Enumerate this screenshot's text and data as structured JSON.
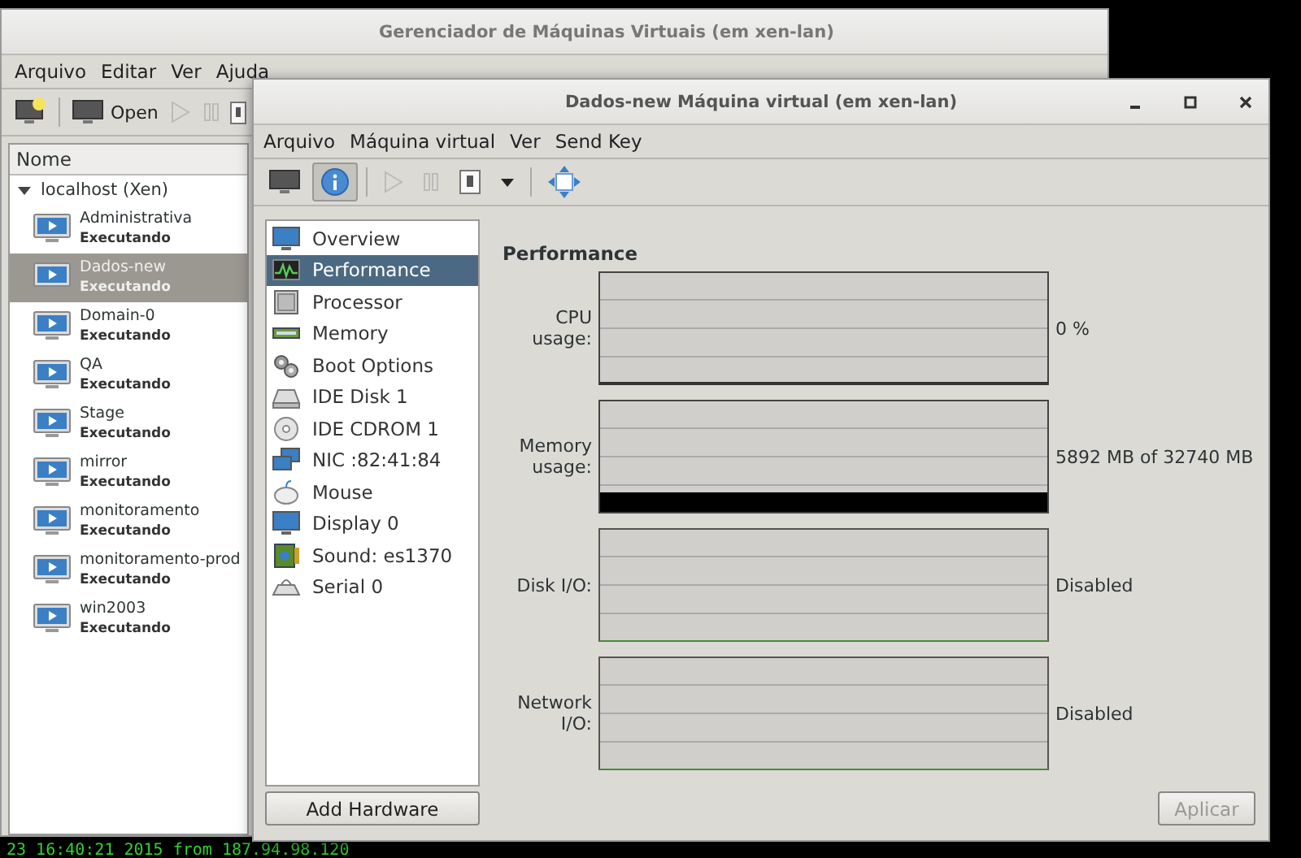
{
  "terminal_line": "23 16:40:21 2015 from 187.94.98.120",
  "back_window": {
    "title": "Gerenciador de Máquinas Virtuais (em xen-lan)",
    "menu": [
      "Arquivo",
      "Editar",
      "Ver",
      "Ajuda"
    ],
    "toolbar": {
      "open_label": "Open"
    },
    "list_header": "Nome",
    "host": {
      "name": "localhost (Xen)",
      "expanded": true
    },
    "vms": [
      {
        "name": "Administrativa",
        "status": "Executando",
        "selected": false
      },
      {
        "name": "Dados-new",
        "status": "Executando",
        "selected": true
      },
      {
        "name": "Domain-0",
        "status": "Executando",
        "selected": false
      },
      {
        "name": "QA",
        "status": "Executando",
        "selected": false
      },
      {
        "name": "Stage",
        "status": "Executando",
        "selected": false
      },
      {
        "name": "mirror",
        "status": "Executando",
        "selected": false
      },
      {
        "name": "monitoramento",
        "status": "Executando",
        "selected": false
      },
      {
        "name": "monitoramento-prod",
        "status": "Executando",
        "selected": false
      },
      {
        "name": "win2003",
        "status": "Executando",
        "selected": false
      }
    ]
  },
  "front_window": {
    "title": "Dados-new Máquina virtual (em xen-lan)",
    "menu": [
      "Arquivo",
      "Máquina virtual",
      "Ver",
      "Send Key"
    ],
    "views": [
      {
        "kind": "console",
        "selected": false
      },
      {
        "kind": "details",
        "selected": true
      }
    ],
    "hardware": [
      {
        "kind": "overview",
        "label": "Overview",
        "selected": false
      },
      {
        "kind": "performance",
        "label": "Performance",
        "selected": true
      },
      {
        "kind": "processor",
        "label": "Processor",
        "selected": false
      },
      {
        "kind": "memory",
        "label": "Memory",
        "selected": false
      },
      {
        "kind": "boot",
        "label": "Boot Options",
        "selected": false
      },
      {
        "kind": "disk",
        "label": "IDE Disk 1",
        "selected": false
      },
      {
        "kind": "cdrom",
        "label": "IDE CDROM 1",
        "selected": false
      },
      {
        "kind": "nic",
        "label": "NIC :82:41:84",
        "selected": false
      },
      {
        "kind": "mouse",
        "label": "Mouse",
        "selected": false
      },
      {
        "kind": "display",
        "label": "Display 0",
        "selected": false
      },
      {
        "kind": "sound",
        "label": "Sound: es1370",
        "selected": false
      },
      {
        "kind": "serial",
        "label": "Serial 0",
        "selected": false
      }
    ],
    "heading": "Performance",
    "metrics": [
      {
        "kind": "cpu",
        "label": "CPU usage:",
        "reading": "0 %"
      },
      {
        "kind": "memory",
        "label": "Memory usage:",
        "reading": "5892 MB of 32740 MB"
      },
      {
        "kind": "disabled",
        "label": "Disk I/O:",
        "reading": "Disabled"
      },
      {
        "kind": "disabled",
        "label": "Network I/O:",
        "reading": "Disabled"
      }
    ],
    "add_button": "Add Hardware",
    "apply_button": {
      "label": "Aplicar",
      "disabled": true
    }
  }
}
